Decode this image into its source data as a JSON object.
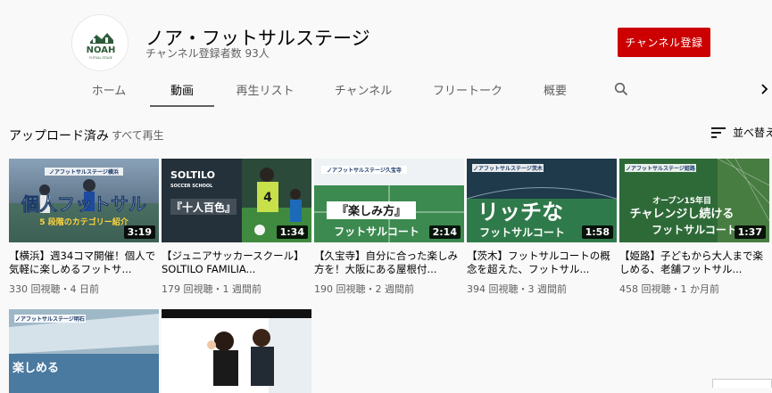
{
  "channel": {
    "name": "ノア・フットサルステージ",
    "subscribers": "チャンネル登録者数 93人",
    "subscribe_label": "チャンネル登録",
    "avatar_text": "NOAH",
    "avatar_sub": "FUTSAL STAGE",
    "brand_color": "#cc0000"
  },
  "tabs": [
    {
      "label": "ホーム"
    },
    {
      "label": "動画"
    },
    {
      "label": "再生リスト"
    },
    {
      "label": "チャンネル"
    },
    {
      "label": "フリートーク"
    },
    {
      "label": "概要"
    }
  ],
  "active_tab": "動画",
  "shelf": {
    "title": "アップロード済み",
    "play_all": "すべて再生",
    "sort_label": "並べ替え"
  },
  "videos": [
    {
      "title": "【横浜】週34コマ開催！個人で気軽に楽しめるフットサ...",
      "meta": "330 回視聴・4 日前",
      "duration": "3:19",
      "thumb_banner": "ノアフットサルステージ横浜",
      "thumb_line1": "個人フットサル",
      "thumb_line2": "5 段階のカテゴリー紹介"
    },
    {
      "title": "【ジュニアサッカースクール】SOLTILO FAMILIA...",
      "meta": "179 回視聴・1 週間前",
      "duration": "1:34",
      "thumb_banner": "SOLTILO",
      "thumb_line1": "SOCCER SCHOOL",
      "thumb_line2": "『十人百色』"
    },
    {
      "title": "【久宝寺】自分に合った楽しみ方を！大阪にある屋根付...",
      "meta": "190 回視聴・2 週間前",
      "duration": "2:14",
      "thumb_banner": "ノアフットサルステージ久宝寺",
      "thumb_line1": "『楽しみ方』",
      "thumb_line2": "フットサルコート"
    },
    {
      "title": "【茨木】フットサルコートの概念を超えた、フットサル...",
      "meta": "394 回視聴・3 週間前",
      "duration": "1:58",
      "thumb_banner": "ノアフットサルステージ茨木",
      "thumb_line1": "リッチな",
      "thumb_line2": "フットサルコート"
    },
    {
      "title": "【姫路】子どもから大人まで楽しめる、老舗フットサル...",
      "meta": "458 回視聴・1 か月前",
      "duration": "1:37",
      "thumb_banner": "ノアフットサルステージ姫路",
      "thumb_line1": "オープン15年目",
      "thumb_line2": "チャレンジし続ける",
      "thumb_line3": "フットサルコート"
    },
    {
      "thumb_banner": "ノアフットサルステージ明石",
      "thumb_line1": "楽しめる"
    },
    {
      "thumb_banner": ""
    }
  ],
  "colors": {
    "text_primary": "#030303",
    "text_secondary": "#606060",
    "background": "#f9f9f9"
  }
}
